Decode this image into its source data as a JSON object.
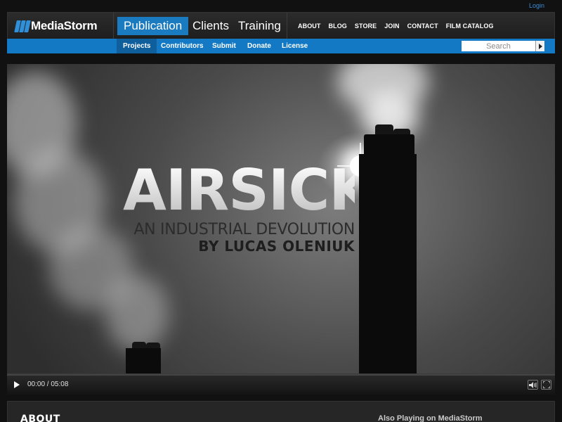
{
  "header": {
    "login_label": "Login",
    "logo_text": "MediaStorm",
    "main_tabs": [
      "Publication",
      "Clients",
      "Training"
    ],
    "top_nav": [
      "ABOUT",
      "BLOG",
      "STORE",
      "JOIN",
      "CONTACT",
      "FILM CATALOG"
    ]
  },
  "subnav": {
    "items": [
      "Projects",
      "Contributors",
      "Submit",
      "Donate",
      "License"
    ],
    "search_placeholder": "Search"
  },
  "video": {
    "title": "AIRSICK",
    "subtitle": "AN INDUSTRIAL DEVOLUTION",
    "byline": "BY LUCAS OLENIUK",
    "time_display": "00:00 / 05:08",
    "progress": 0
  },
  "footer": {
    "about_title": "ABOUT",
    "also_playing": "Also Playing on MediaStorm"
  },
  "colors": {
    "accent_blue": "#1b7bc0",
    "link_blue": "#3a8ed6",
    "background": "#111111"
  }
}
